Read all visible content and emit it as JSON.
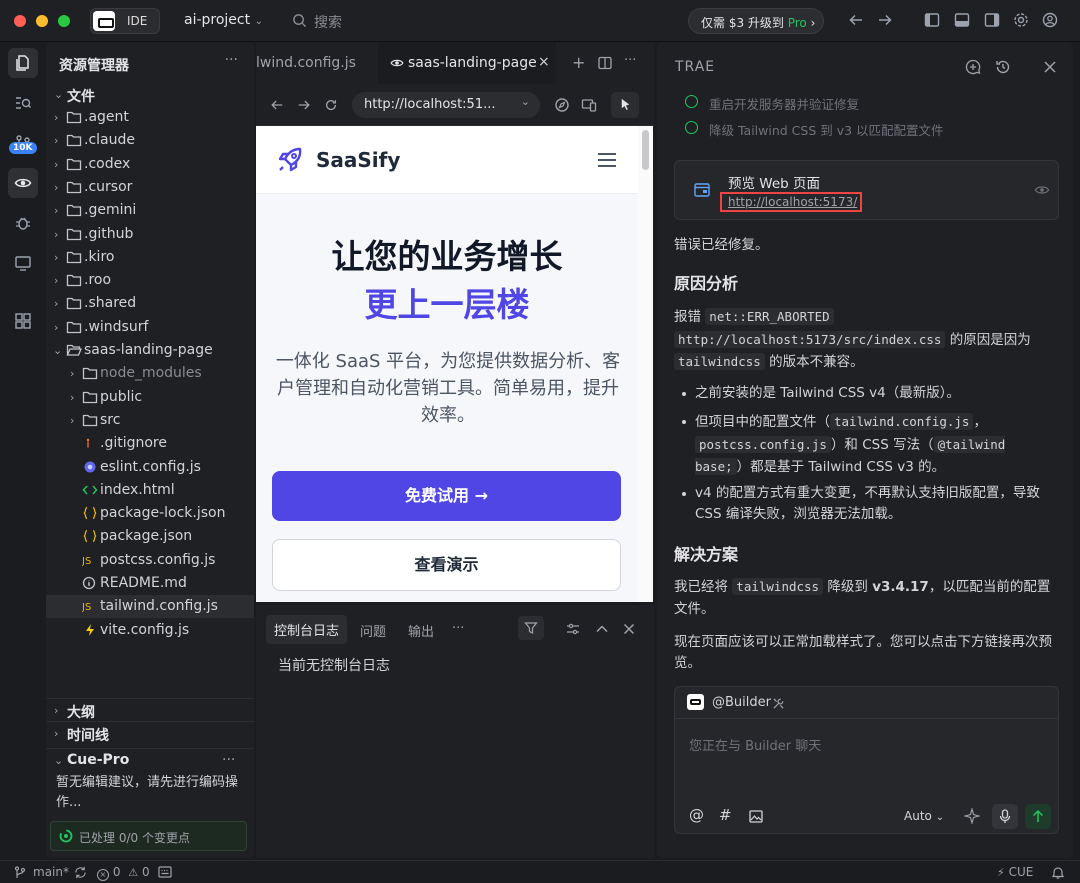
{
  "titlebar": {
    "ide_label": "IDE",
    "project": "ai-project",
    "search_placeholder": "搜索",
    "promo_prefix": "仅需 $3 升级到",
    "promo_pro": "Pro",
    "promo_arrow": "›"
  },
  "activity": {
    "badge": "10K"
  },
  "explorer": {
    "title": "资源管理器",
    "more": "···",
    "root": "文件",
    "items": [
      {
        "label": ".agent"
      },
      {
        "label": ".claude"
      },
      {
        "label": ".codex"
      },
      {
        "label": ".cursor"
      },
      {
        "label": ".gemini"
      },
      {
        "label": ".github"
      },
      {
        "label": ".kiro"
      },
      {
        "label": ".roo"
      },
      {
        "label": ".shared"
      },
      {
        "label": ".windsurf"
      },
      {
        "label": "saas-landing-page"
      },
      {
        "label": "node_modules"
      },
      {
        "label": "public"
      },
      {
        "label": "src"
      },
      {
        "label": ".gitignore"
      },
      {
        "label": "eslint.config.js"
      },
      {
        "label": "index.html"
      },
      {
        "label": "package-lock.json"
      },
      {
        "label": "package.json"
      },
      {
        "label": "postcss.config.js"
      },
      {
        "label": "README.md"
      },
      {
        "label": "tailwind.config.js"
      },
      {
        "label": "vite.config.js"
      }
    ],
    "outline": "大纲",
    "timeline": "时间线",
    "cue_title": "Cue-Pro",
    "cue_more": "···",
    "cue_text": "暂无编辑建议，请先进行编码操作...",
    "cue_status": "已处理 0/0 个变更点"
  },
  "editor": {
    "tab1": "lwind.config.js",
    "tab2": "saas-landing-page",
    "tab_close": "×",
    "tab_add": "+",
    "tab_more": "···",
    "url": "http://localhost:51...",
    "url_chevron": "⌄"
  },
  "preview": {
    "brand": "SaaSify",
    "headline1": "让您的业务增长",
    "headline2": "更上一层楼",
    "desc": "一体化 SaaS 平台，为您提供数据分析、客户管理和自动化营销工具。简单易用，提升效率。",
    "cta_primary": "免费试用",
    "cta_arrow": "→",
    "cta_secondary": "查看演示"
  },
  "console": {
    "tabs": [
      "控制台日志",
      "问题",
      "输出"
    ],
    "more": "···",
    "empty": "当前无控制台日志"
  },
  "assistant": {
    "title": "TRAE",
    "done": [
      "重启开发服务器并验证修复",
      "降级 Tailwind CSS 到 v3 以匹配配置文件"
    ],
    "preview_title": "预览 Web 页面",
    "preview_url": "http://localhost:5173/",
    "fixed": "错误已经修复。",
    "h_cause": "原因分析",
    "cause_p1": "报错",
    "cause_code1": "net::ERR_ABORTED",
    "cause_code2": "http://localhost:5173/src/index.css",
    "cause_p2": "的原因是因为",
    "cause_code3": "tailwindcss",
    "cause_p3": "的版本不兼容。",
    "b1": "之前安装的是 Tailwind CSS v4（最新版）。",
    "b2_a": "但项目中的配置文件（",
    "b2_code1": "tailwind.config.js",
    "b2_b": "，",
    "b2_code2": "postcss.config.js",
    "b2_c": "）和 CSS 写法（",
    "b2_code3": "@tailwind base;",
    "b2_d": "）都是基于 Tailwind CSS v3 的。",
    "b3": "v4 的配置方式有重大变更，不再默认支持旧版配置，导致 CSS 编译失败，浏览器无法加载。",
    "h_fix": "解决方案",
    "fix_a": "我已经将",
    "fix_code": "tailwindcss",
    "fix_b": "降级到",
    "fix_ver": "v3.4.17",
    "fix_c": "，以匹配当前的配置文件。",
    "fix2": "现在页面应该可以正常加载样式了。您可以点击下方链接再次预览。",
    "chat_agent": "@Builder",
    "chat_placeholder": "您正在与 Builder 聊天",
    "chat_at": "@",
    "chat_hash": "#",
    "model": "Auto"
  },
  "status": {
    "branch": "main*",
    "errors": "0",
    "warnings": "0",
    "cue": "CUE"
  },
  "colors": {
    "accent": "#4f46e5",
    "pro": "#22c55e",
    "highlight": "#ef4444"
  }
}
